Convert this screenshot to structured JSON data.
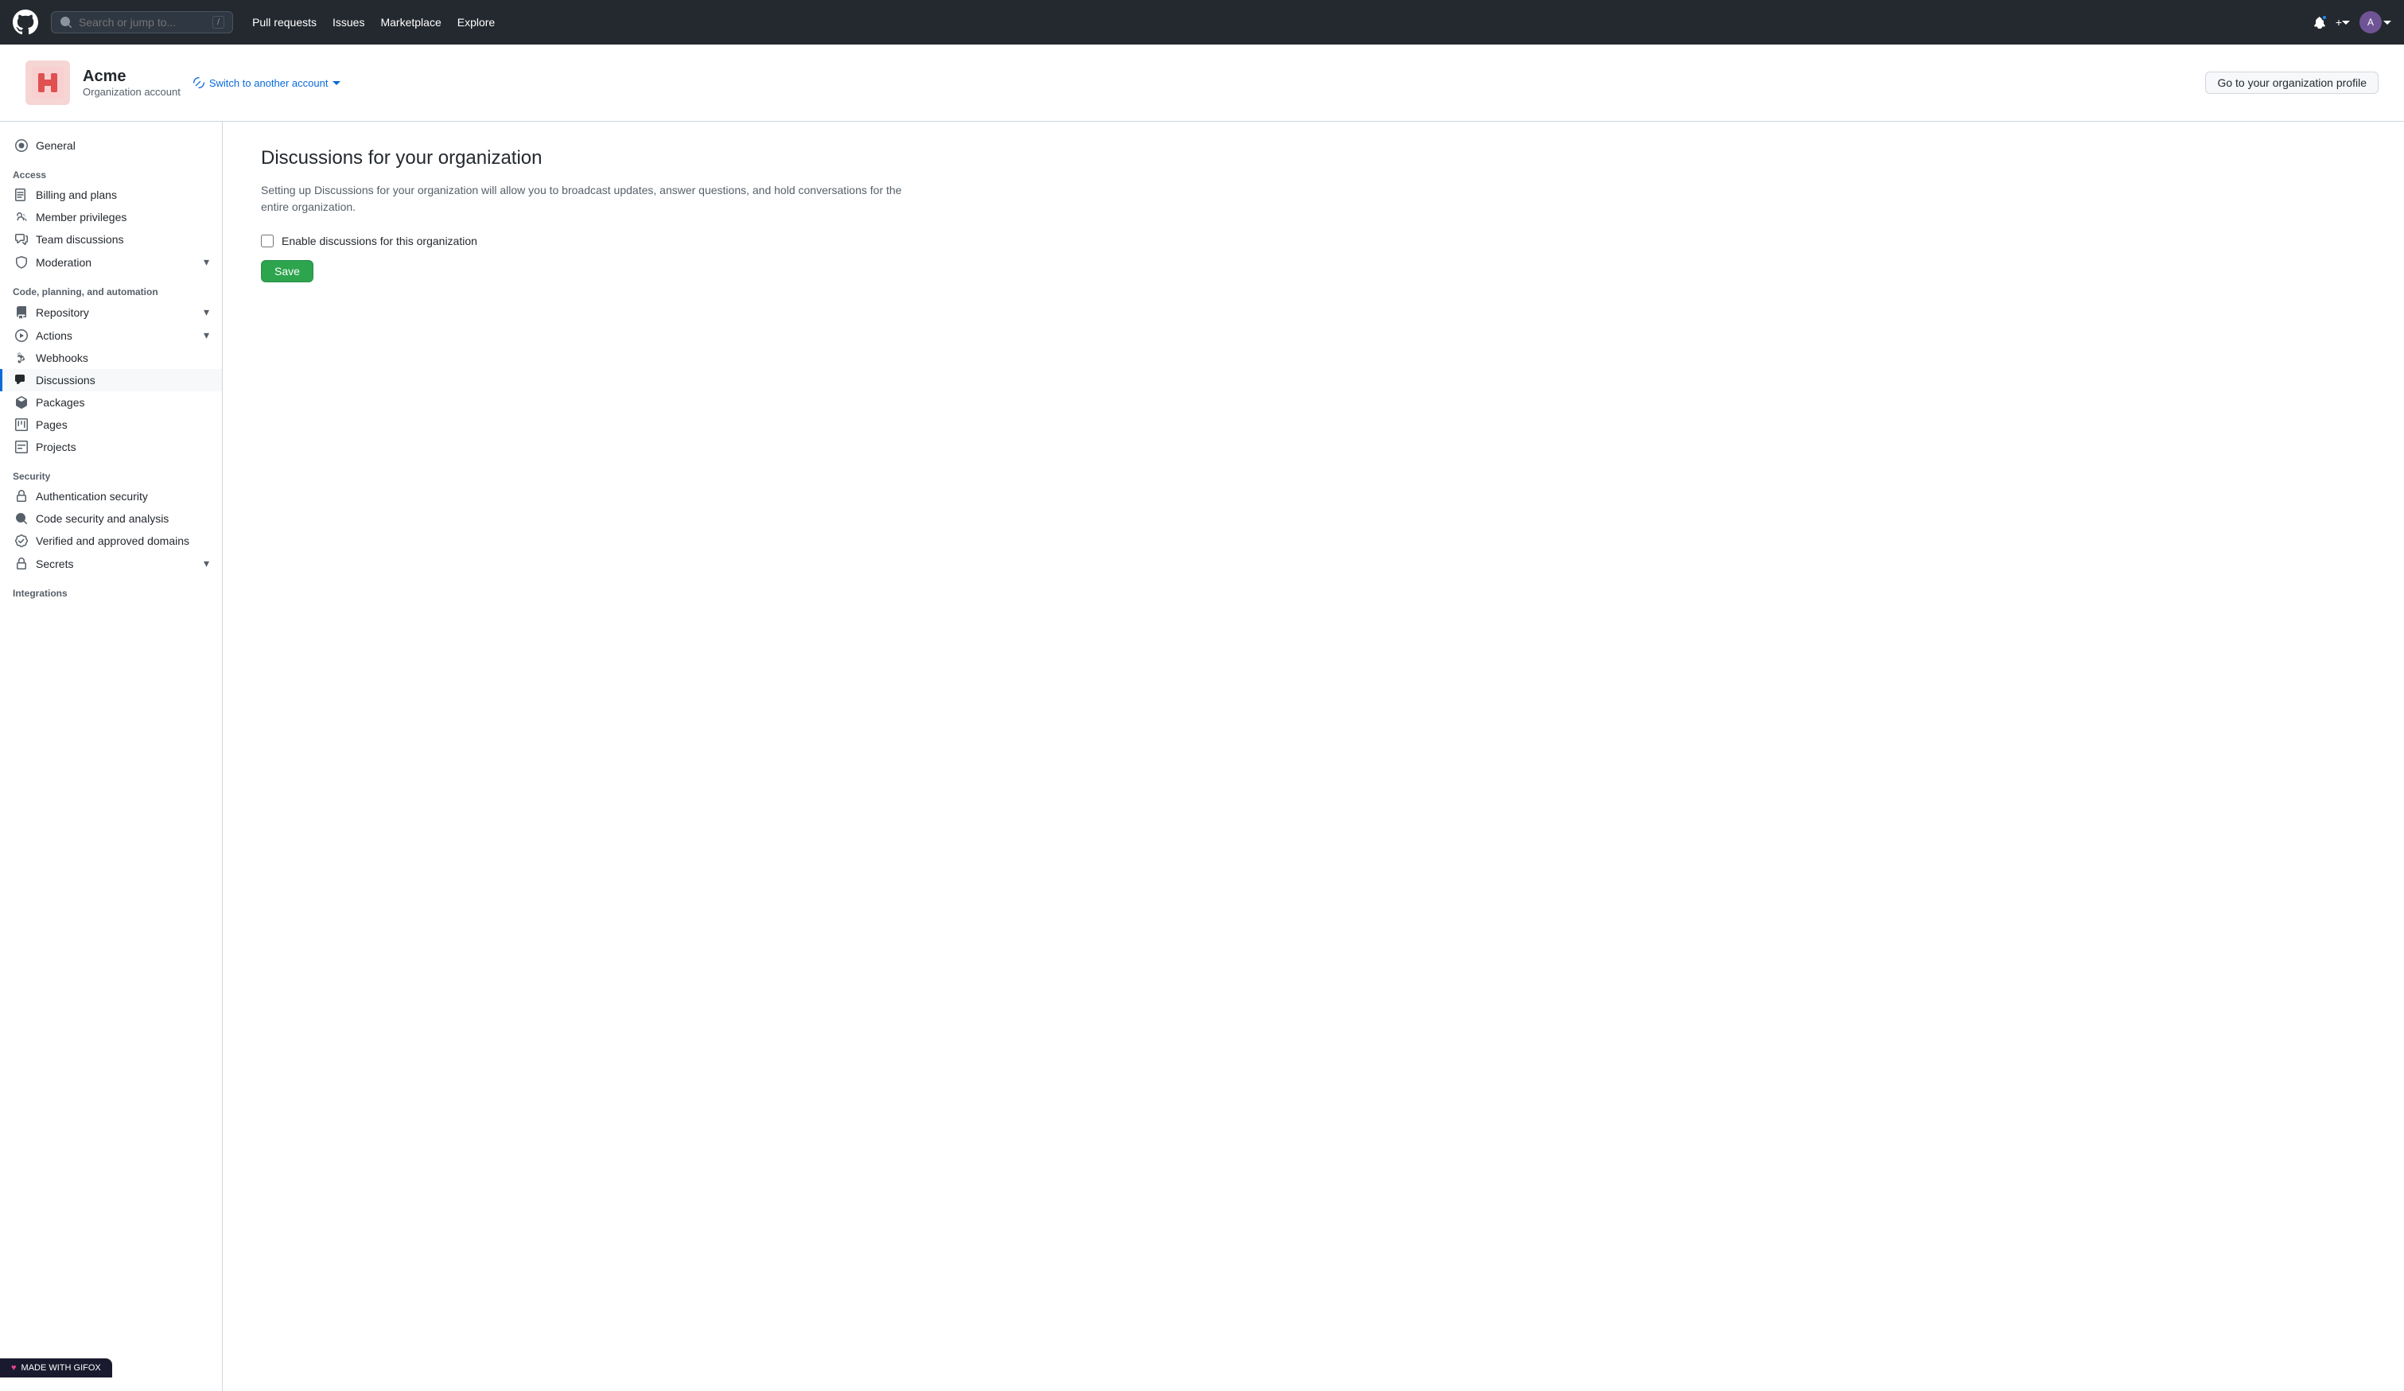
{
  "topnav": {
    "search_placeholder": "Search or jump to...",
    "slash_hint": "/",
    "links": [
      {
        "label": "Pull requests",
        "key": "pull-requests"
      },
      {
        "label": "Issues",
        "key": "issues"
      },
      {
        "label": "Marketplace",
        "key": "marketplace"
      },
      {
        "label": "Explore",
        "key": "explore"
      }
    ],
    "add_button": "+",
    "add_dropdown": "▾"
  },
  "org": {
    "name": "Acme",
    "type": "Organization account",
    "switch_label": "Switch to another account",
    "profile_btn": "Go to your organization profile"
  },
  "sidebar": {
    "general_label": "General",
    "sections": [
      {
        "label": "Access",
        "items": [
          {
            "key": "billing",
            "label": "Billing and plans",
            "icon": "billing",
            "expandable": false
          },
          {
            "key": "member-privileges",
            "label": "Member privileges",
            "icon": "members",
            "expandable": false
          },
          {
            "key": "team-discussions",
            "label": "Team discussions",
            "icon": "discussions",
            "expandable": false
          },
          {
            "key": "moderation",
            "label": "Moderation",
            "icon": "moderation",
            "expandable": true
          }
        ]
      },
      {
        "label": "Code, planning, and automation",
        "items": [
          {
            "key": "repository",
            "label": "Repository",
            "icon": "repo",
            "expandable": true
          },
          {
            "key": "actions",
            "label": "Actions",
            "icon": "actions",
            "expandable": true
          },
          {
            "key": "webhooks",
            "label": "Webhooks",
            "icon": "webhooks",
            "expandable": false
          },
          {
            "key": "discussions",
            "label": "Discussions",
            "icon": "discussions",
            "expandable": false,
            "active": true
          },
          {
            "key": "packages",
            "label": "Packages",
            "icon": "packages",
            "expandable": false
          },
          {
            "key": "pages",
            "label": "Pages",
            "icon": "pages",
            "expandable": false
          },
          {
            "key": "projects",
            "label": "Projects",
            "icon": "projects",
            "expandable": false
          }
        ]
      },
      {
        "label": "Security",
        "items": [
          {
            "key": "auth-security",
            "label": "Authentication security",
            "icon": "auth",
            "expandable": false
          },
          {
            "key": "code-security",
            "label": "Code security and analysis",
            "icon": "codesec",
            "expandable": false
          },
          {
            "key": "verified-domains",
            "label": "Verified and approved domains",
            "icon": "verified",
            "expandable": false
          },
          {
            "key": "secrets",
            "label": "Secrets",
            "icon": "secrets",
            "expandable": true
          }
        ]
      },
      {
        "label": "Integrations",
        "items": []
      }
    ]
  },
  "main": {
    "title": "Discussions for your organization",
    "description": "Setting up Discussions for your organization will allow you to broadcast updates, answer questions, and hold conversations for the entire organization.",
    "checkbox_label": "Enable discussions for this organization",
    "checkbox_checked": false,
    "save_button": "Save"
  },
  "gifox": {
    "label": "MADE WITH GIFOX"
  }
}
